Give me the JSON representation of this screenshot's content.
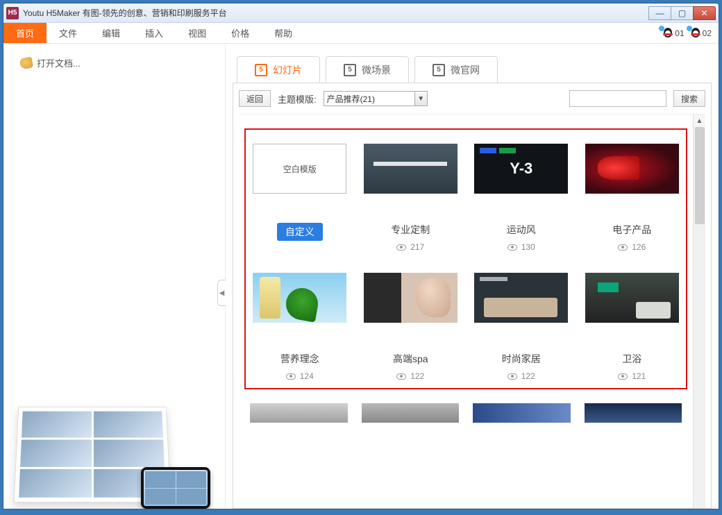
{
  "window": {
    "title": "Youtu H5Maker 有图-领先的创意、营销和印刷服务平台",
    "appicon": "H5"
  },
  "menubar": {
    "items": [
      "首页",
      "文件",
      "编辑",
      "插入",
      "视图",
      "价格",
      "帮助"
    ],
    "active_index": 0,
    "qq": [
      {
        "label": "01"
      },
      {
        "label": "02"
      }
    ]
  },
  "sidebar": {
    "open_label": "打开文档..."
  },
  "tabs": {
    "items": [
      "幻灯片",
      "微场景",
      "微官网"
    ],
    "active_index": 0
  },
  "toolbar": {
    "back_label": "返回",
    "theme_label": "主题模版:",
    "select_value": "产品推荐(21)",
    "search_button": "搜索"
  },
  "templates": [
    {
      "title": "空白模版",
      "badge": "自定义",
      "views": null,
      "style": "blank"
    },
    {
      "title": "专业定制",
      "views": 217,
      "style": "t-room"
    },
    {
      "title": "运动风",
      "views": 130,
      "style": "t-y3"
    },
    {
      "title": "电子产品",
      "views": 126,
      "style": "t-elec"
    },
    {
      "title": "营养理念",
      "views": 124,
      "style": "t-leaf"
    },
    {
      "title": "高端spa",
      "views": 122,
      "style": "t-spa"
    },
    {
      "title": "时尚家居",
      "views": 122,
      "style": "t-home"
    },
    {
      "title": "卫浴",
      "views": 121,
      "style": "t-bath"
    }
  ]
}
